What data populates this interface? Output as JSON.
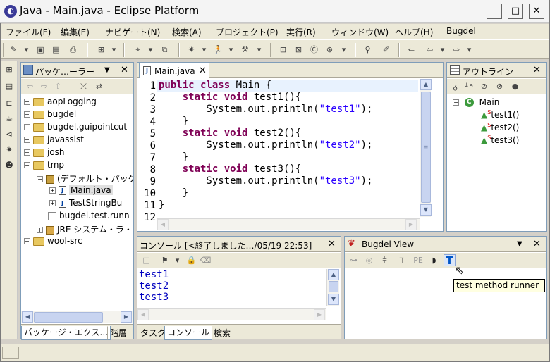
{
  "window": {
    "title": "Java - Main.java - Eclipse Platform"
  },
  "menu": [
    "ファイル(F)",
    "編集(E)",
    "ナビゲート(N)",
    "検索(A)",
    "プロジェクト(P)",
    "実行(R)",
    "ウィンドウ(W)",
    "ヘルプ(H)",
    "Bugdel"
  ],
  "package_explorer": {
    "title": "パッケ…ーラー",
    "items": [
      {
        "label": "aopLogging",
        "type": "project",
        "expander": "+"
      },
      {
        "label": "bugdel",
        "type": "project",
        "expander": "+"
      },
      {
        "label": "bugdel.guipointcut",
        "type": "project",
        "expander": "+"
      },
      {
        "label": "javassist",
        "type": "project",
        "expander": "+"
      },
      {
        "label": "josh",
        "type": "project",
        "expander": "+"
      },
      {
        "label": "tmp",
        "type": "project",
        "expander": "−"
      },
      {
        "label": "(デフォルト・パッケ",
        "type": "package",
        "expander": "−"
      },
      {
        "label": "Main.java",
        "type": "java",
        "expander": "+"
      },
      {
        "label": "TestStringBu",
        "type": "java",
        "expander": "+"
      },
      {
        "label": "bugdel.test.runn",
        "type": "jar",
        "expander": ""
      },
      {
        "label": "JRE システム・ラ・",
        "type": "library",
        "expander": "+"
      },
      {
        "label": "wool-src",
        "type": "project",
        "expander": "+"
      }
    ],
    "tabs": [
      "パッケージ・エクス…",
      "階層"
    ]
  },
  "editor": {
    "tab": "Main.java",
    "line_numbers": [
      "1",
      "2",
      "3",
      "4",
      "5",
      "6",
      "7",
      "8",
      "9",
      "10",
      "11",
      "12"
    ],
    "lines": [
      [
        {
          "k": "kw",
          "t": "public class"
        },
        {
          "k": "",
          "t": " Main {"
        }
      ],
      [
        {
          "k": "",
          "t": "    "
        },
        {
          "k": "kw",
          "t": "static void"
        },
        {
          "k": "",
          "t": " test1(){"
        }
      ],
      [
        {
          "k": "",
          "t": "        System.out.println("
        },
        {
          "k": "str",
          "t": "\"test1\""
        },
        {
          "k": "",
          "t": ");"
        }
      ],
      [
        {
          "k": "",
          "t": "    }"
        }
      ],
      [
        {
          "k": "",
          "t": "    "
        },
        {
          "k": "kw",
          "t": "static void"
        },
        {
          "k": "",
          "t": " test2(){"
        }
      ],
      [
        {
          "k": "",
          "t": "        System.out.println("
        },
        {
          "k": "str",
          "t": "\"test2\""
        },
        {
          "k": "",
          "t": ");"
        }
      ],
      [
        {
          "k": "",
          "t": "    }"
        }
      ],
      [
        {
          "k": "",
          "t": "    "
        },
        {
          "k": "kw",
          "t": "static void"
        },
        {
          "k": "",
          "t": " test3(){"
        }
      ],
      [
        {
          "k": "",
          "t": "        System.out.println("
        },
        {
          "k": "str",
          "t": "\"test3\""
        },
        {
          "k": "",
          "t": ");"
        }
      ],
      [
        {
          "k": "",
          "t": "    }"
        }
      ],
      [
        {
          "k": "",
          "t": "}"
        }
      ],
      [
        {
          "k": "",
          "t": ""
        }
      ]
    ]
  },
  "outline": {
    "title": "アウトライン",
    "root": "Main",
    "methods": [
      "test1()",
      "test2()",
      "test3()"
    ],
    "static_marker": "S"
  },
  "console": {
    "title": "コンソール [<終了しました…/05/19 22:53]",
    "output": [
      "test1",
      "test2",
      "test3"
    ],
    "tabs": [
      "タスク",
      "コンソール",
      "検索"
    ]
  },
  "bugdel_view": {
    "title": "Bugdel View",
    "toolbar_labels": [
      "PE",
      "T"
    ]
  },
  "tooltip": "test method runner",
  "colors": {
    "keyword": "#7f0055",
    "string": "#2a00ff",
    "console_text": "#0000c0"
  }
}
